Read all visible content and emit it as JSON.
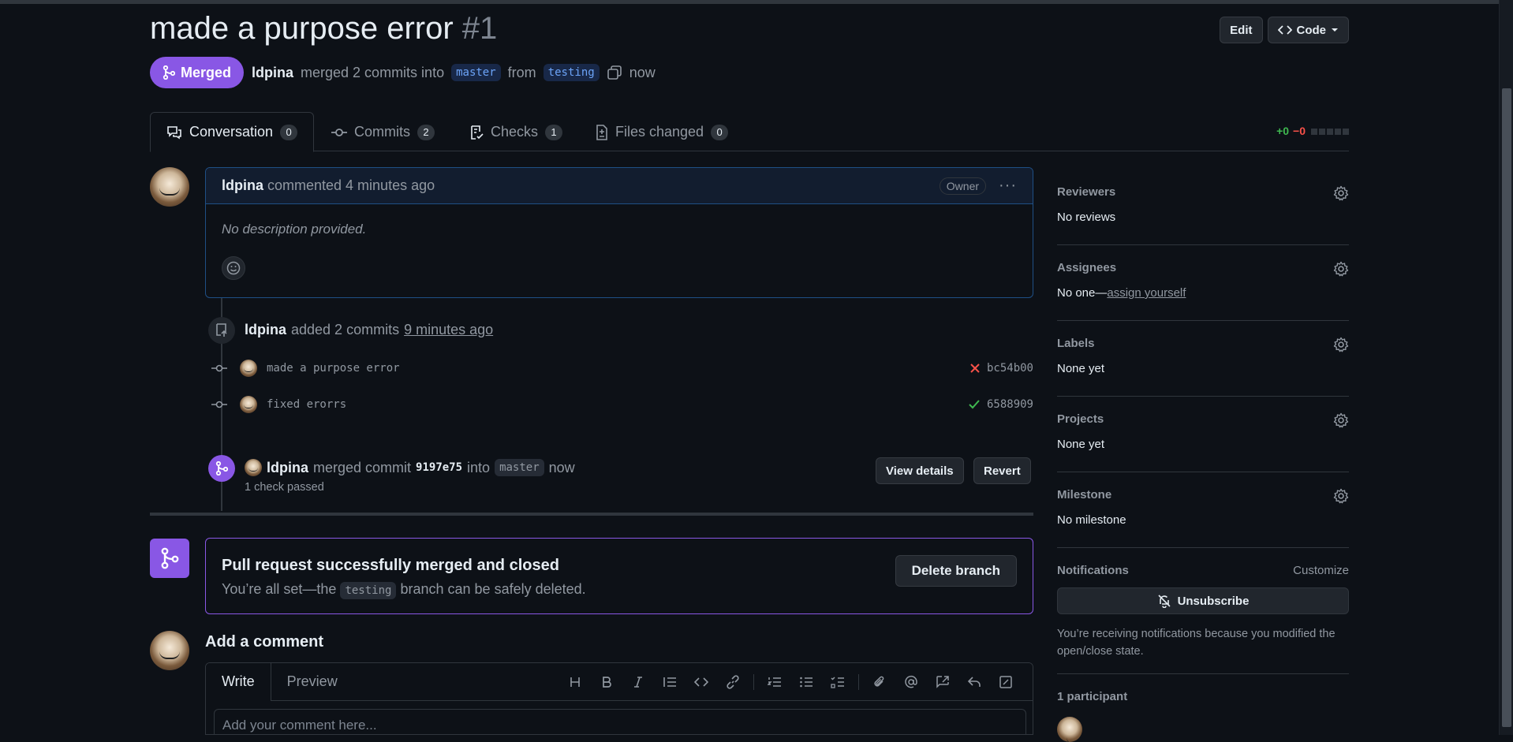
{
  "pr": {
    "title": "made a purpose error",
    "number": "#1",
    "state": "Merged",
    "author": "ldpina",
    "merged_text": "merged 2 commits into",
    "base_branch": "master",
    "from_word": "from",
    "head_branch": "testing",
    "time": "now"
  },
  "header_buttons": {
    "edit": "Edit",
    "code": "Code"
  },
  "tabs": [
    {
      "label": "Conversation",
      "count": "0"
    },
    {
      "label": "Commits",
      "count": "2"
    },
    {
      "label": "Checks",
      "count": "1"
    },
    {
      "label": "Files changed",
      "count": "0"
    }
  ],
  "diffstat": {
    "additions": "+0",
    "deletions": "−0"
  },
  "comment": {
    "author": "ldpina",
    "action": "commented 4 minutes ago",
    "role": "Owner",
    "body": "No description provided."
  },
  "commits_event": {
    "author": "ldpina",
    "text": "added 2 commits",
    "time": "9 minutes ago",
    "commits": [
      {
        "message": "made a purpose error",
        "sha": "bc54b00",
        "status": "failure"
      },
      {
        "message": "fixed erorrs",
        "sha": "6588909",
        "status": "success"
      }
    ]
  },
  "merge_event": {
    "author": "ldpina",
    "text": "merged commit",
    "sha": "9197e75",
    "into": "into",
    "branch": "master",
    "time": "now",
    "checks": "1 check passed",
    "view_details": "View details",
    "revert": "Revert"
  },
  "merged_box": {
    "title": "Pull request successfully merged and closed",
    "sub_before": "You’re all set—the",
    "branch": "testing",
    "sub_after": "branch can be safely deleted.",
    "delete_button": "Delete branch"
  },
  "add_comment": {
    "heading": "Add a comment",
    "write_tab": "Write",
    "preview_tab": "Preview",
    "placeholder": "Add your comment here..."
  },
  "sidebar": {
    "reviewers": {
      "heading": "Reviewers",
      "value": "No reviews"
    },
    "assignees": {
      "heading": "Assignees",
      "value": "No one—",
      "link": "assign yourself"
    },
    "labels": {
      "heading": "Labels",
      "value": "None yet"
    },
    "projects": {
      "heading": "Projects",
      "value": "None yet"
    },
    "milestone": {
      "heading": "Milestone",
      "value": "No milestone"
    },
    "notifications": {
      "heading": "Notifications",
      "customize": "Customize",
      "button": "Unsubscribe",
      "reason": "You’re receiving notifications because you modified the open/close state."
    },
    "participants": {
      "heading": "1 participant"
    }
  },
  "colors": {
    "merged": "#8957e5",
    "link_blue": "#6ca4f8",
    "success": "#3fb950",
    "danger": "#f85149",
    "background": "#0d1117"
  }
}
